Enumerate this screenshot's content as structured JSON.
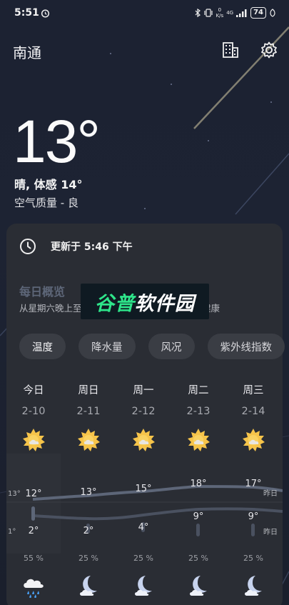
{
  "status_bar": {
    "time": "5:51",
    "speed_top": "0",
    "speed_bottom": "K/s",
    "network": "4G",
    "battery": "74"
  },
  "header": {
    "city": "南通"
  },
  "current": {
    "temperature": "13°",
    "description": "晴, 体感 14°",
    "air_quality": "空气质量 - 良"
  },
  "card": {
    "updated": "更新于 5:46 下午",
    "daily_title": "每日概览",
    "daily_subtitle": "从星期六晚上至",
    "daily_subtitle_tail": "健康",
    "watermark_a": "谷普",
    "watermark_b": "软件园",
    "tabs": [
      "温度",
      "降水量",
      "风况",
      "紫外线指数"
    ]
  },
  "days": [
    {
      "name": "今日",
      "date": "2-10",
      "high": "12°",
      "low": "2°",
      "precip": "55 %",
      "icon": "sun-cloud-icon",
      "bottom_icon": "cloud-rain-icon"
    },
    {
      "name": "周日",
      "date": "2-11",
      "high": "13°",
      "low": "2°",
      "precip": "25 %",
      "icon": "sun-cloud-icon",
      "bottom_icon": "moon-cloud-icon"
    },
    {
      "name": "周一",
      "date": "2-12",
      "high": "15°",
      "low": "4°",
      "precip": "25 %",
      "icon": "sun-cloud-icon",
      "bottom_icon": "moon-cloud-icon"
    },
    {
      "name": "周二",
      "date": "2-13",
      "high": "18°",
      "low": "9°",
      "precip": "25 %",
      "icon": "sun-cloud-icon",
      "bottom_icon": "moon-cloud-icon"
    },
    {
      "name": "周三",
      "date": "2-14",
      "high": "17°",
      "low": "9°",
      "precip": "25 %",
      "icon": "sun-cloud-icon",
      "bottom_icon": "moon-cloud-icon"
    }
  ],
  "chart": {
    "left_high": "13°",
    "left_low": "1°",
    "yesterday_high": "昨日",
    "yesterday_low": "昨日"
  },
  "colors": {
    "background": "#1b2130",
    "card": "#2a2d34",
    "sun": "#f6c44a"
  }
}
